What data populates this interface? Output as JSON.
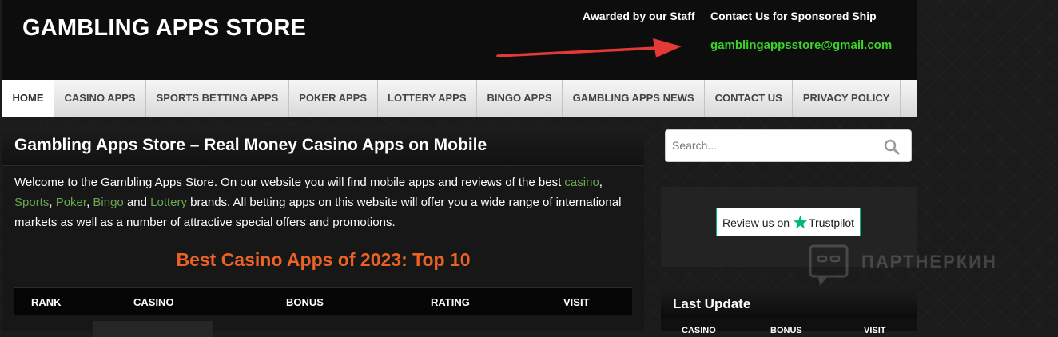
{
  "header": {
    "site_title": "GAMBLING APPS STORE",
    "awarded_link": "Awarded by our Staff",
    "contact_link": "Contact Us for Sponsored Ship",
    "email": "gamblingappsstore@gmail.com",
    "arrow_color": "#e53935"
  },
  "nav": {
    "items": [
      {
        "label": "HOME"
      },
      {
        "label": "CASINO APPS"
      },
      {
        "label": "SPORTS BETTING APPS"
      },
      {
        "label": "POKER APPS"
      },
      {
        "label": "LOTTERY APPS"
      },
      {
        "label": "BINGO APPS"
      },
      {
        "label": "GAMBLING APPS NEWS"
      },
      {
        "label": "CONTACT US"
      },
      {
        "label": "PRIVACY POLICY"
      }
    ]
  },
  "main": {
    "title": "Gambling Apps Store – Real Money Casino Apps on Mobile",
    "intro": {
      "t1": "Welcome to the Gambling Apps Store. On our website you will find mobile apps and reviews of the best ",
      "l_casino": "casino",
      "t2": ",",
      "l_sports": "Sports",
      "t3": ", ",
      "l_poker": "Poker",
      "t4": ", ",
      "l_bingo": "Bingo",
      "t5": " and ",
      "l_lottery": "Lottery",
      "t6": " brands. All betting apps on this website will offer you a wide range of international markets as well as a number of attractive special offers and promotions."
    },
    "top10_heading": "Best Casino Apps of 2023: Top 10",
    "table_headers": [
      "RANK",
      "CASINO",
      "BONUS",
      "RATING",
      "VISIT"
    ]
  },
  "sidebar": {
    "search_placeholder": "Search...",
    "trustpilot": {
      "review_text": "Review us on",
      "brand": "Trustpilot"
    },
    "watermark_text": "ПАРТНЕРКИН",
    "last_update": {
      "title": "Last Update",
      "headers": [
        "CASINO",
        "BONUS",
        "VISIT"
      ]
    }
  },
  "colors": {
    "accent_orange": "#ec6224",
    "email_green": "#3cd22a",
    "link_green": "#6aa84f",
    "trustpilot_green": "#00b67a"
  }
}
